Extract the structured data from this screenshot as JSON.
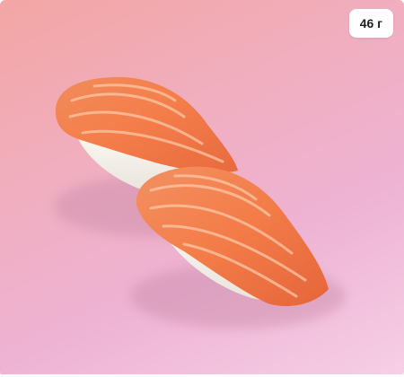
{
  "product_card": {
    "weight_badge": "46 г",
    "image": {
      "icon": "salmon-nigiri-image",
      "background_colors": [
        "#f3a6a4",
        "#eeb3d3",
        "#f6cfe6"
      ],
      "fish_color": "#f07d4c",
      "rice_color": "#f4f1ea"
    }
  }
}
